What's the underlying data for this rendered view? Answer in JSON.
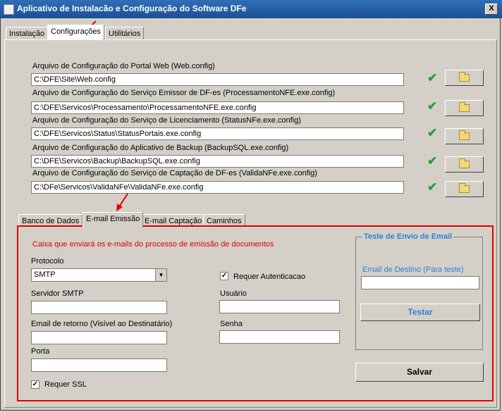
{
  "window": {
    "title": "Aplicativo de Instalacão e Configuração do Software DFe",
    "close_label": "X"
  },
  "main_tabs": [
    {
      "label": "Instalação",
      "active": false
    },
    {
      "label": "Configurações",
      "active": true
    },
    {
      "label": "Utilitários",
      "active": false
    }
  ],
  "config_files": [
    {
      "label": "Arquivo de Configuração do Portal Web (Web.config)",
      "path": "C:\\DFE\\Site\\Web.config",
      "valid": true
    },
    {
      "label": "Arquivo de Configuração do Serviço Emissor de DF-es (ProcessamentoNFE.exe.config)",
      "path": "C:\\DFE\\Servicos\\Processamento\\ProcessamentoNFE.exe.config",
      "valid": true
    },
    {
      "label": "Arquivo de Configuração do Serviço de Licenciamento (StatusNFe.exe.config)",
      "path": "C:\\DFE\\Servicos\\Status\\StatusPortais.exe.config",
      "valid": true
    },
    {
      "label": "Arquivo de Configuração do Aplicativo de Backup (BackupSQL.exe.config)",
      "path": "C:\\DFE\\Servicos\\Backup\\BackupSQL.exe.config",
      "valid": true
    },
    {
      "label": "Arquivo de Configuração do Serviço de Captação de DF-es (ValidaNFe.exe.config)",
      "path": "C:\\DFe\\Servicos\\ValidaNFe\\ValidaNFe.exe.config",
      "valid": true
    }
  ],
  "sub_tabs": [
    {
      "label": "Banco de Dados",
      "active": false
    },
    {
      "label": "E-mail Emissão",
      "active": true
    },
    {
      "label": "E-mail Captação",
      "active": false
    },
    {
      "label": "Caminhos",
      "active": false
    }
  ],
  "email": {
    "description": "Caixa que enviará os e-mails do processo de emissão de documentos",
    "protocol_label": "Protocolo",
    "protocol_value": "SMTP",
    "smtp_label": "Servidor SMTP",
    "smtp_value": "",
    "reply_label": "Email de retorno (Visível ao Destinatário)",
    "reply_value": "",
    "port_label": "Porta",
    "port_value": "",
    "ssl_label": "Requer SSL",
    "ssl_checked": true,
    "auth_label": "Requer Autenticacao",
    "auth_checked": true,
    "user_label": "Usuário",
    "user_value": "",
    "password_label": "Senha",
    "password_value": ""
  },
  "test_group": {
    "title": "Teste de Envio de Email",
    "dest_label": "Email de Destino (Para teste)",
    "dest_value": "",
    "test_button": "Testar"
  },
  "save_button": "Salvar",
  "colors": {
    "titlebar": "#1f5aa6",
    "highlight_border": "#e00000",
    "description_text": "#e00000",
    "group_title": "#2f7fd8",
    "check": "#2e9d32"
  }
}
